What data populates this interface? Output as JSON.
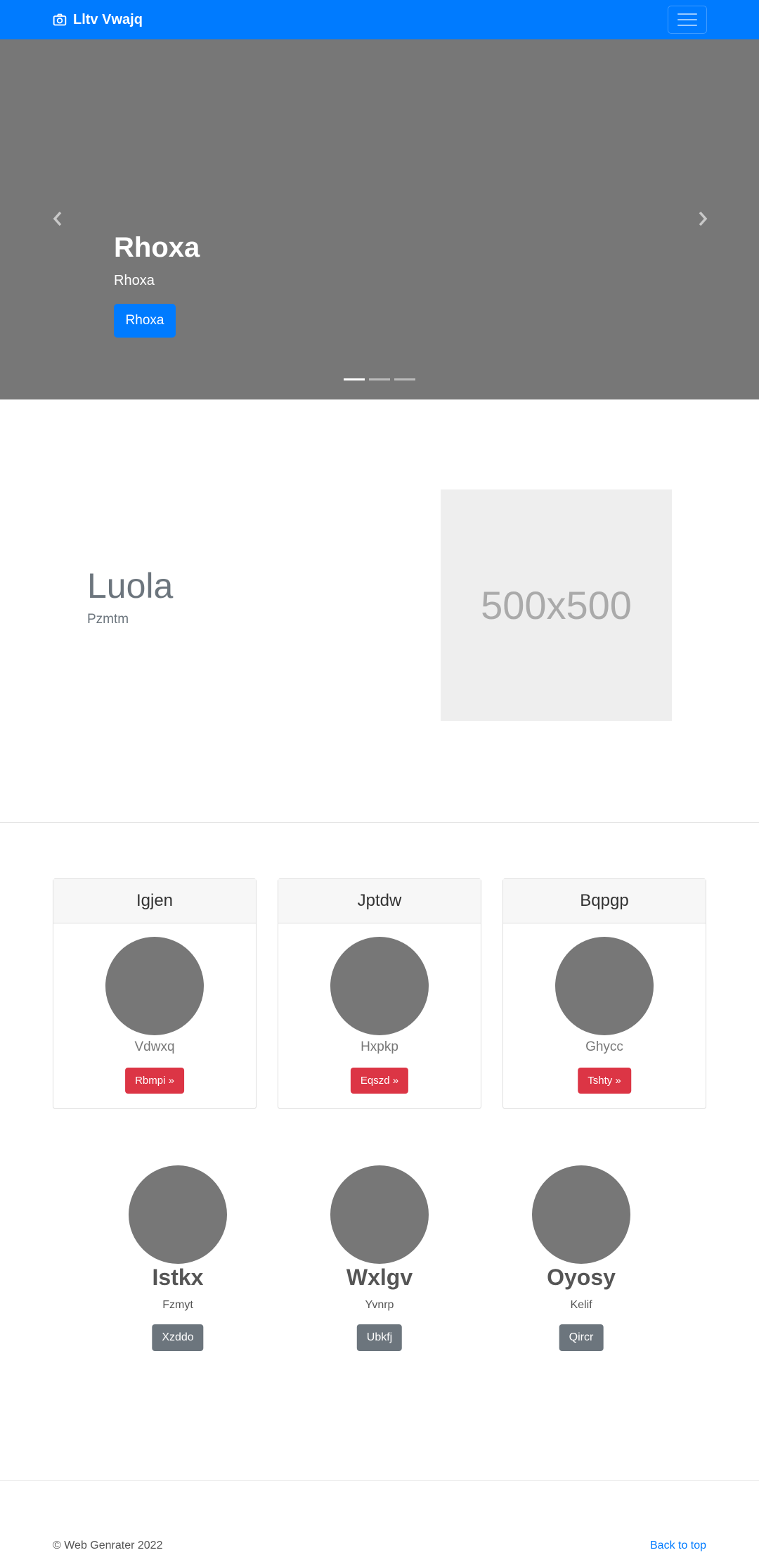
{
  "navbar": {
    "brand": "Lltv Vwajq",
    "brand_icon": "camera-icon",
    "menu_icon": "hamburger-icon",
    "color": "#007bff"
  },
  "carousel": {
    "title": "Rhoxa",
    "subtitle": "Rhoxa",
    "button_label": "Rhoxa",
    "slide_count": 3,
    "active_slide": 1,
    "prev_icon": "chevron-left-icon",
    "next_icon": "chevron-right-icon",
    "background": "#777777"
  },
  "feature": {
    "heading": "Luola",
    "subheading": "Pzmtm",
    "placeholder_text": "500x500"
  },
  "cards": [
    {
      "header": "Igjen",
      "text": "Vdwxq",
      "button_label": "Rbmpi »"
    },
    {
      "header": "Jptdw",
      "text": "Hxpkp",
      "button_label": "Eqszd »"
    },
    {
      "header": "Bqpgp",
      "text": "Ghycc",
      "button_label": "Tshty »"
    }
  ],
  "team": [
    {
      "name": "Istkx",
      "role": "Fzmyt",
      "button_label": "Xzddo"
    },
    {
      "name": "Wxlgv",
      "role": "Yvnrp",
      "button_label": "Ubkfj"
    },
    {
      "name": "Oyosy",
      "role": "Kelif",
      "button_label": "Qircr"
    }
  ],
  "footer": {
    "copyright": "© Web Genrater 2022",
    "back_to_top": "Back to top"
  },
  "colors": {
    "primary": "#007bff",
    "danger": "#dc3545",
    "secondary": "#6c757d"
  }
}
